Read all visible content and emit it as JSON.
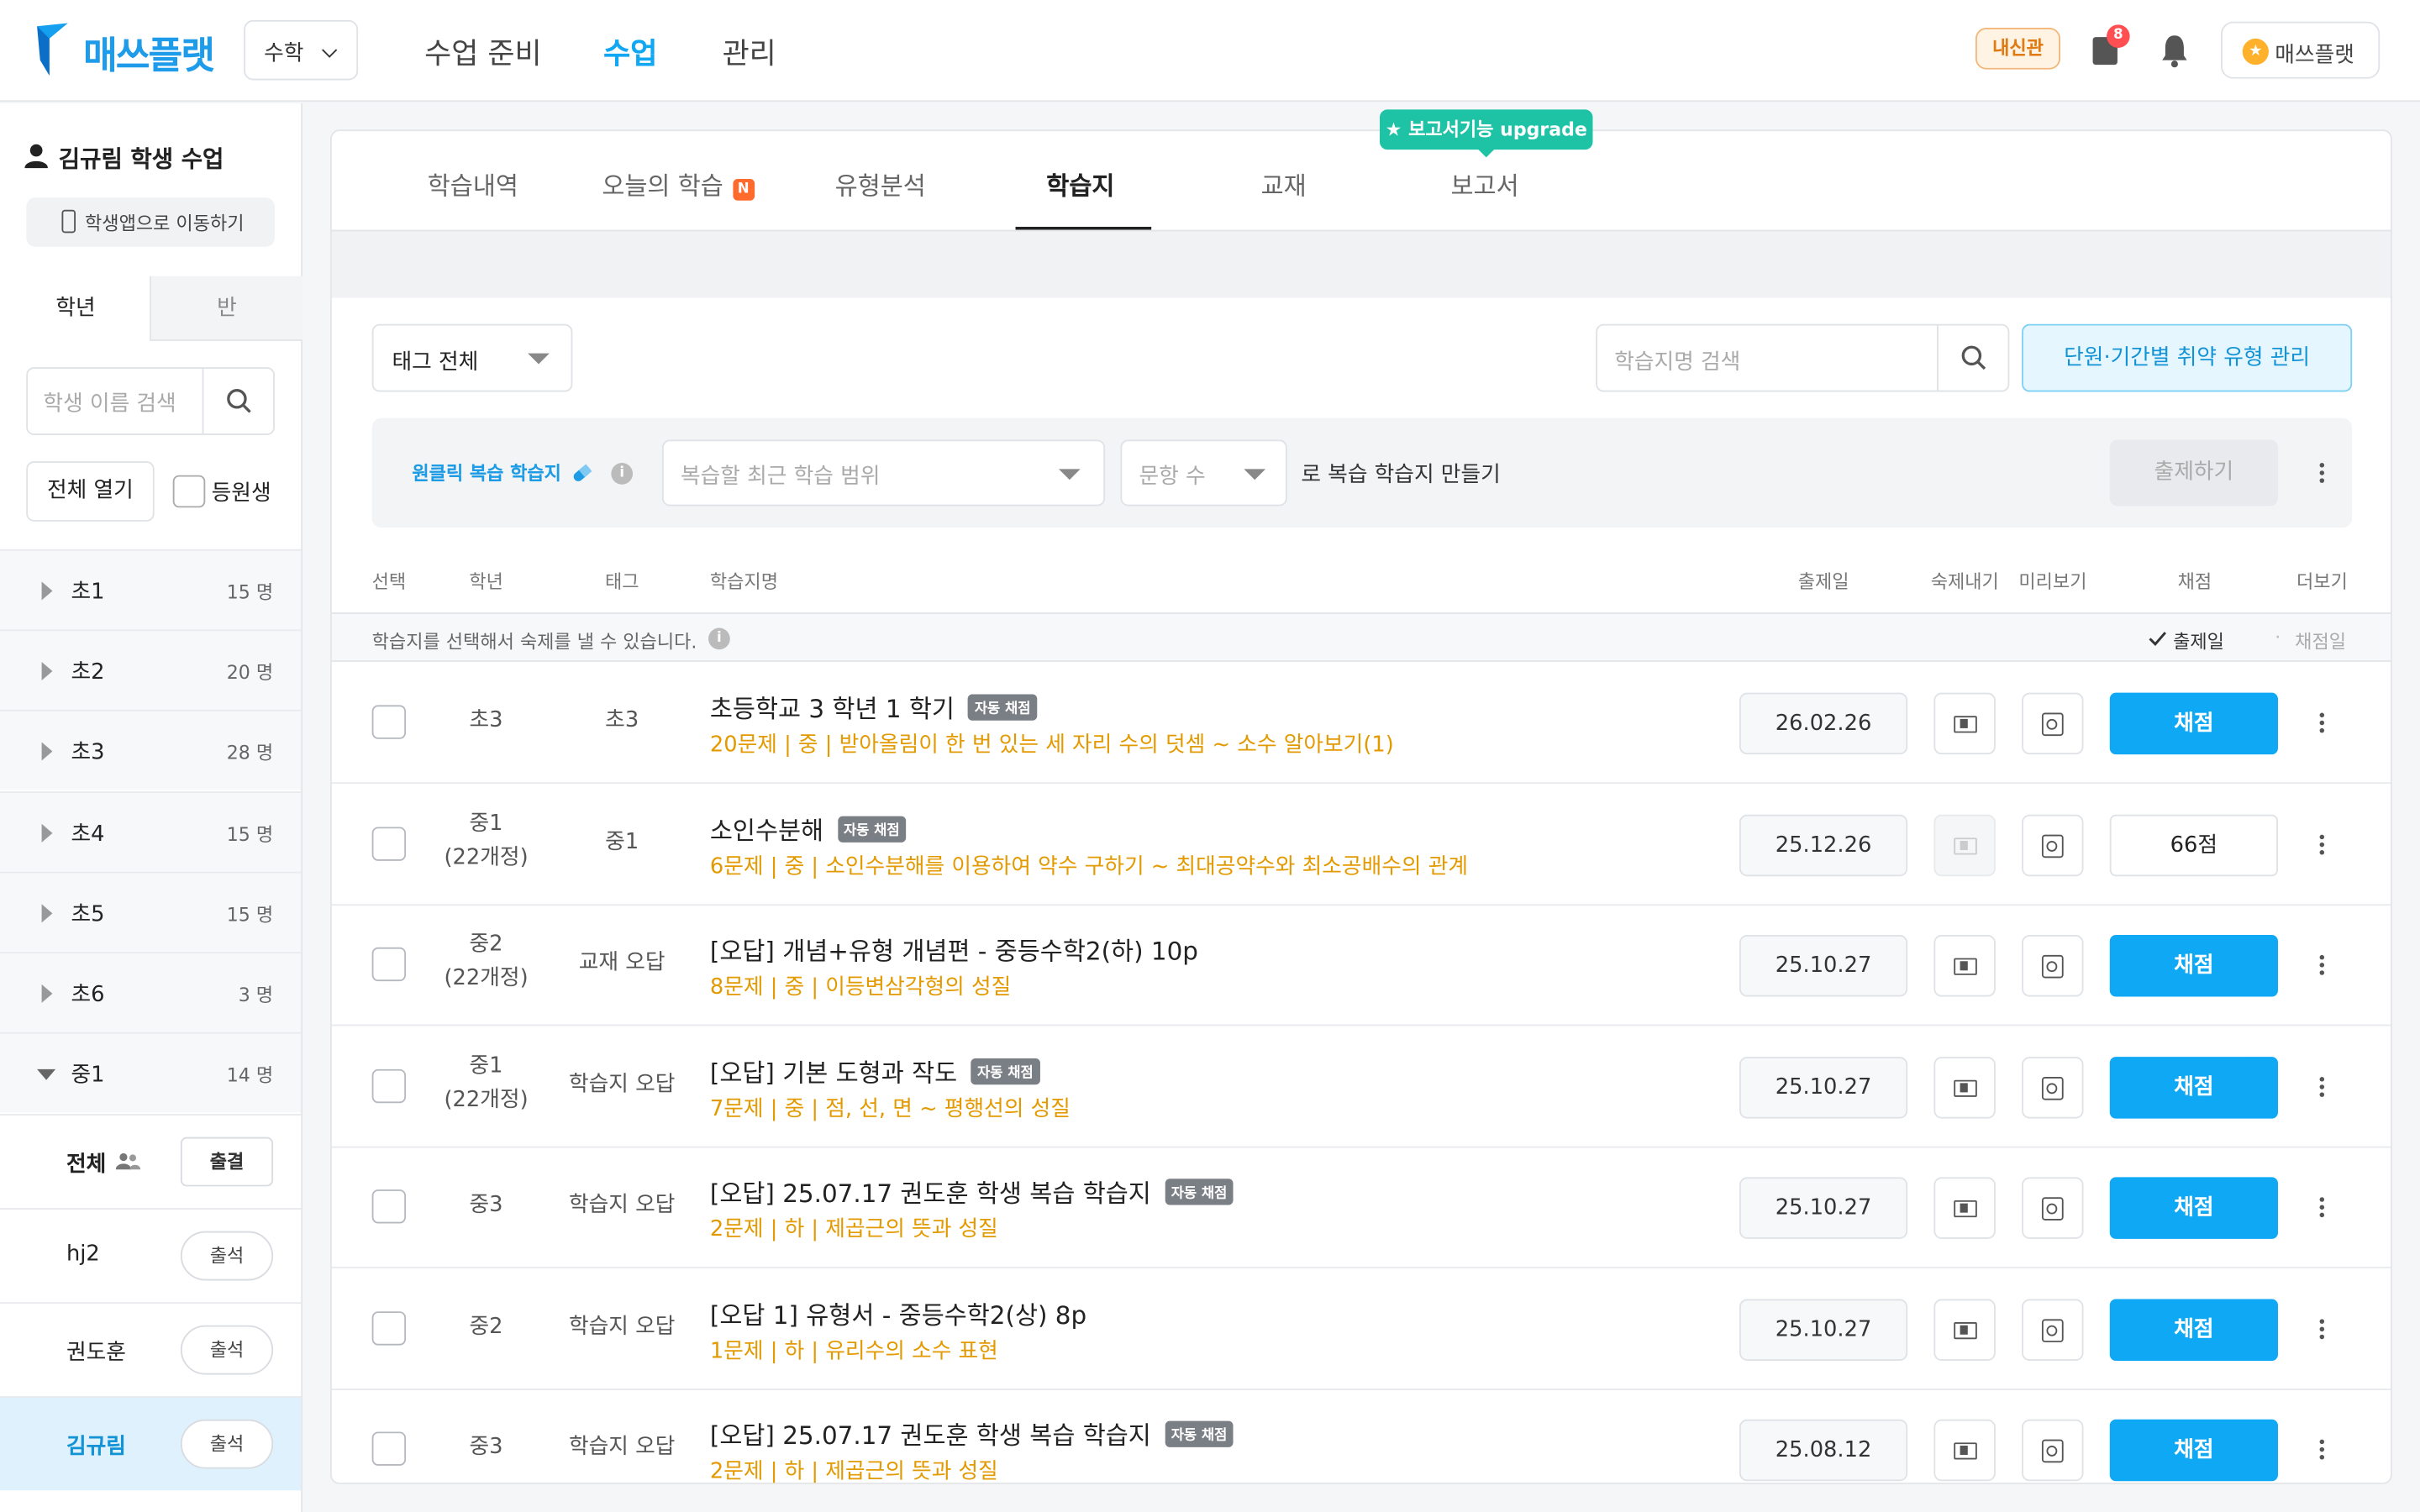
{
  "header": {
    "logo_text": "매쓰플랫",
    "subject": "수학",
    "nav": [
      "수업 준비",
      "수업",
      "관리"
    ],
    "active_nav": "수업",
    "badge_label": "내신관",
    "notification_count": "8",
    "user_label": "매쓰플랫",
    "accent_color": "#11a7f2"
  },
  "sidebar": {
    "title": "김규림 학생 수업",
    "move_app_label": "학생앱으로 이동하기",
    "tabs": [
      "학년",
      "반"
    ],
    "search_placeholder": "학생 이름 검색",
    "open_all_label": "전체 열기",
    "enrolled_label": "등원생",
    "grades": [
      {
        "name": "초1",
        "count": "15 명"
      },
      {
        "name": "초2",
        "count": "20 명"
      },
      {
        "name": "초3",
        "count": "28 명"
      },
      {
        "name": "초4",
        "count": "15 명"
      },
      {
        "name": "초5",
        "count": "15 명"
      },
      {
        "name": "초6",
        "count": "3 명"
      },
      {
        "name": "중1",
        "count": "14 명"
      }
    ],
    "all_row": {
      "label": "전체",
      "button": "출결"
    },
    "students": [
      {
        "name": "hj2",
        "button": "출석"
      },
      {
        "name": "권도훈",
        "button": "출석"
      },
      {
        "name": "김규림",
        "button": "출석"
      }
    ]
  },
  "main": {
    "tabs": [
      "학습내역",
      "오늘의 학습",
      "유형분석",
      "학습지",
      "교재",
      "보고서"
    ],
    "new_badge": "N",
    "active_tab": "학습지",
    "upgrade_label": "★ 보고서기능 upgrade",
    "tag_filter": "태그 전체",
    "search_placeholder": "학습지명 검색",
    "weak_type_button": "단원·기간별 취약 유형 관리",
    "one_click_label": "원클릭 복습 학습지",
    "range_placeholder": "복습할 최근 학습 범위",
    "count_placeholder": "문항 수",
    "make_label": "로 복습 학습지 만들기",
    "issue_button": "출제하기",
    "columns": {
      "select": "선택",
      "grade": "학년",
      "tag": "태그",
      "name": "학습지명",
      "date": "출제일",
      "homework": "숙제내기",
      "preview": "미리보기",
      "grade_btn": "채점",
      "more": "더보기"
    },
    "hint": "학습지를 선택해서 숙제를 낼 수 있습니다.",
    "sort_active": "출제일",
    "sort_inactive": "채점일",
    "rows": [
      {
        "grade": "초3",
        "grade_sub": "",
        "tag": "초3",
        "name": "초등학교 3 학년 1 학기",
        "auto": "자동 채점",
        "sub": "20문제 | 중 | 받아올림이 한 번 있는 세 자리 수의 덧셈 ~ 소수 알아보기(1)",
        "date": "26.02.26",
        "action": "채점",
        "scored": false,
        "hw_disabled": false
      },
      {
        "grade": "중1",
        "grade_sub": "(22개정)",
        "tag": "중1",
        "name": "소인수분해",
        "auto": "자동 채점",
        "sub": "6문제 | 중 | 소인수분해를 이용하여 약수 구하기 ~ 최대공약수와 최소공배수의 관계",
        "date": "25.12.26",
        "action": "66점",
        "scored": true,
        "hw_disabled": true
      },
      {
        "grade": "중2",
        "grade_sub": "(22개정)",
        "tag": "교재 오답",
        "name": "[오답] 개념+유형 개념편 - 중등수학2(하) 10p",
        "auto": "",
        "sub": "8문제 | 중 | 이등변삼각형의 성질",
        "date": "25.10.27",
        "action": "채점",
        "scored": false,
        "hw_disabled": false
      },
      {
        "grade": "중1",
        "grade_sub": "(22개정)",
        "tag": "학습지 오답",
        "name": "[오답] 기본 도형과 작도",
        "auto": "자동 채점",
        "sub": "7문제 | 중 | 점, 선, 면 ~ 평행선의 성질",
        "date": "25.10.27",
        "action": "채점",
        "scored": false,
        "hw_disabled": false
      },
      {
        "grade": "중3",
        "grade_sub": "",
        "tag": "학습지 오답",
        "name": "[오답] 25.07.17 권도훈 학생 복습 학습지",
        "auto": "자동 채점",
        "sub": "2문제 | 하 | 제곱근의 뜻과 성질",
        "date": "25.10.27",
        "action": "채점",
        "scored": false,
        "hw_disabled": false
      },
      {
        "grade": "중2",
        "grade_sub": "",
        "tag": "학습지 오답",
        "name": "[오답 1] 유형서 - 중등수학2(상) 8p",
        "auto": "",
        "sub": "1문제 | 하 | 유리수의 소수 표현",
        "date": "25.10.27",
        "action": "채점",
        "scored": false,
        "hw_disabled": false
      },
      {
        "grade": "중3",
        "grade_sub": "",
        "tag": "학습지 오답",
        "name": "[오답] 25.07.17 권도훈 학생 복습 학습지",
        "auto": "자동 채점",
        "sub": "2문제 | 하 | 제곱근의 뜻과 성질",
        "date": "25.08.12",
        "action": "채점",
        "scored": false,
        "hw_disabled": false
      }
    ]
  }
}
